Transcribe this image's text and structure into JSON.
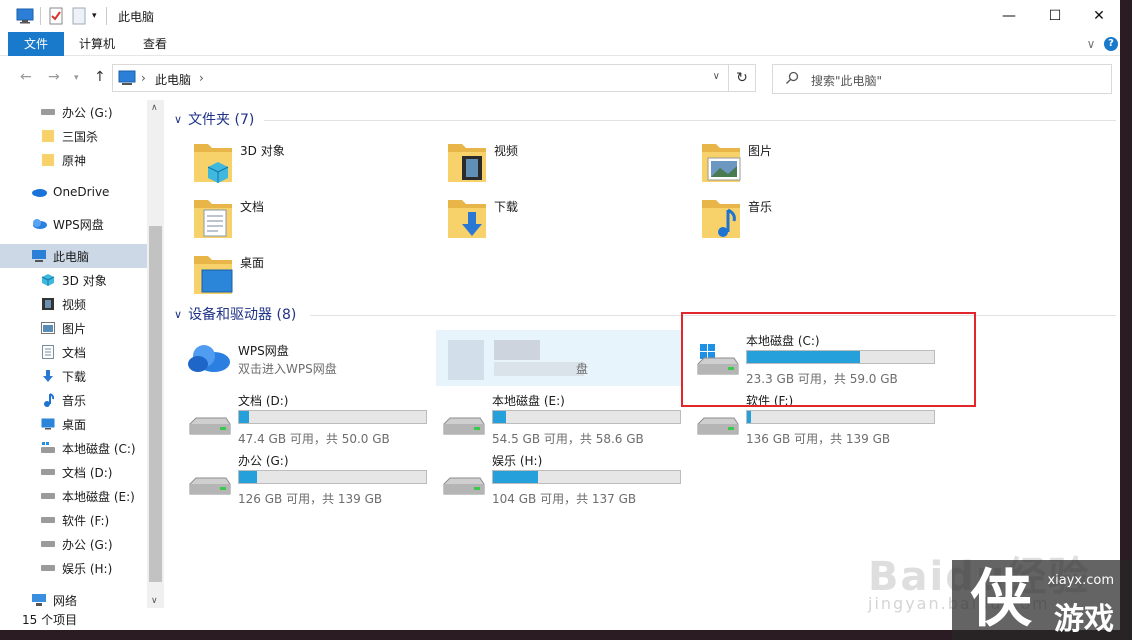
{
  "window": {
    "title": "此电脑",
    "minimize": "—",
    "maximize": "☐",
    "close": "✕"
  },
  "ribbon": {
    "tabs": [
      "文件",
      "计算机",
      "查看"
    ],
    "collapse": "∨",
    "help": "?"
  },
  "address": {
    "path": "此电脑",
    "separator": "›",
    "search_placeholder": "搜索\"此电脑\""
  },
  "sidebar": {
    "items": [
      {
        "label": "办公 (G:)",
        "icon": "drive-icon"
      },
      {
        "label": "三国杀",
        "icon": "folder-icon"
      },
      {
        "label": "原神",
        "icon": "folder-icon"
      },
      {
        "label": "OneDrive",
        "icon": "onedrive-icon"
      },
      {
        "label": "WPS网盘",
        "icon": "wps-cloud-icon"
      },
      {
        "label": "此电脑",
        "icon": "pc-icon"
      },
      {
        "label": "3D 对象",
        "icon": "3d-objects-icon"
      },
      {
        "label": "视频",
        "icon": "video-icon"
      },
      {
        "label": "图片",
        "icon": "pictures-icon"
      },
      {
        "label": "文档",
        "icon": "documents-icon"
      },
      {
        "label": "下载",
        "icon": "download-icon"
      },
      {
        "label": "音乐",
        "icon": "music-icon"
      },
      {
        "label": "桌面",
        "icon": "desktop-icon"
      },
      {
        "label": "本地磁盘 (C:)",
        "icon": "windows-drive-icon"
      },
      {
        "label": "文档 (D:)",
        "icon": "drive-icon"
      },
      {
        "label": "本地磁盘 (E:)",
        "icon": "drive-icon"
      },
      {
        "label": "软件 (F:)",
        "icon": "drive-icon"
      },
      {
        "label": "办公 (G:)",
        "icon": "drive-icon"
      },
      {
        "label": "娱乐 (H:)",
        "icon": "drive-icon"
      },
      {
        "label": "网络",
        "icon": "network-icon"
      }
    ]
  },
  "folders_group": {
    "label": "文件夹 (7)"
  },
  "folders": [
    {
      "name": "3D 对象",
      "icon": "3d-objects-icon"
    },
    {
      "name": "视频",
      "icon": "video-icon"
    },
    {
      "name": "图片",
      "icon": "pictures-icon"
    },
    {
      "name": "文档",
      "icon": "documents-icon"
    },
    {
      "name": "下载",
      "icon": "download-icon"
    },
    {
      "name": "音乐",
      "icon": "music-icon"
    },
    {
      "name": "桌面",
      "icon": "desktop-icon"
    }
  ],
  "devices_group": {
    "label": "设备和驱动器 (8)"
  },
  "wps": {
    "name": "WPS网盘",
    "desc": "双击进入WPS网盘"
  },
  "blurred_item_suffix": "盘",
  "drives": [
    {
      "name": "本地磁盘 (C:)",
      "info": "23.3 GB 可用，共 59.0 GB",
      "used_fraction": 0.605,
      "system": true
    },
    {
      "name": "文档 (D:)",
      "info": "47.4 GB 可用，共 50.0 GB",
      "used_fraction": 0.052
    },
    {
      "name": "本地磁盘 (E:)",
      "info": "54.5 GB 可用，共 58.6 GB",
      "used_fraction": 0.07
    },
    {
      "name": "软件 (F:)",
      "info": "136 GB 可用，共 139 GB",
      "used_fraction": 0.022
    },
    {
      "name": "办公 (G:)",
      "info": "126 GB 可用，共 139 GB",
      "used_fraction": 0.094
    },
    {
      "name": "娱乐 (H:)",
      "info": "104 GB 可用，共 137 GB",
      "used_fraction": 0.241
    }
  ],
  "status": {
    "count": "15 个项目"
  },
  "watermark": {
    "text": "Baidu经验",
    "sub": "jingyan.baidu.com"
  },
  "logo": {
    "url": "xiayx.com",
    "name": "游戏",
    "big": "侠"
  },
  "colors": {
    "accent": "#1979ca",
    "bar_fill": "#26a0da",
    "highlight": "#e3262b",
    "selected": "#ccd8e6"
  }
}
